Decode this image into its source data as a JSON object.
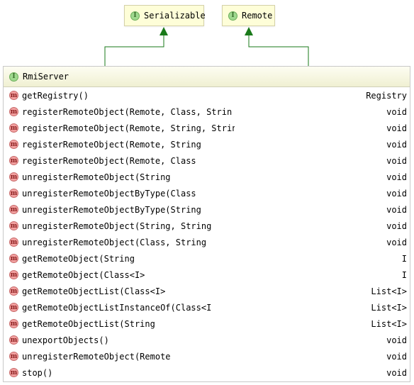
{
  "parents": [
    {
      "name": "Serializable",
      "badge": "I"
    },
    {
      "name": "Remote",
      "badge": "I"
    }
  ],
  "class": {
    "name": "RmiServer",
    "badge": "I",
    "methods": [
      {
        "badge": "m",
        "name": "getRegistry()",
        "type": "Registry"
      },
      {
        "badge": "m",
        "name": "registerRemoteObject(Remote, Class, Strin",
        "type": "void"
      },
      {
        "badge": "m",
        "name": "registerRemoteObject(Remote, String, Strin",
        "type": "void"
      },
      {
        "badge": "m",
        "name": "registerRemoteObject(Remote, String",
        "type": "void"
      },
      {
        "badge": "m",
        "name": "registerRemoteObject(Remote, Class",
        "type": "void"
      },
      {
        "badge": "m",
        "name": "unregisterRemoteObject(String",
        "type": "void"
      },
      {
        "badge": "m",
        "name": "unregisterRemoteObjectByType(Class",
        "type": "void"
      },
      {
        "badge": "m",
        "name": "unregisterRemoteObjectByType(String",
        "type": "void"
      },
      {
        "badge": "m",
        "name": "unregisterRemoteObject(String, String",
        "type": "void"
      },
      {
        "badge": "m",
        "name": "unregisterRemoteObject(Class, String",
        "type": "void"
      },
      {
        "badge": "m",
        "name": "getRemoteObject(String",
        "type": "I"
      },
      {
        "badge": "m",
        "name": "getRemoteObject(Class<I>",
        "type": "I"
      },
      {
        "badge": "m",
        "name": "getRemoteObjectList(Class<I>",
        "type": "List<I>"
      },
      {
        "badge": "m",
        "name": "getRemoteObjectListInstanceOf(Class<I",
        "type": "List<I>"
      },
      {
        "badge": "m",
        "name": "getRemoteObjectList(String",
        "type": "List<I>"
      },
      {
        "badge": "m",
        "name": "unexportObjects()",
        "type": "void"
      },
      {
        "badge": "m",
        "name": "unregisterRemoteObject(Remote",
        "type": "void"
      },
      {
        "badge": "m",
        "name": "stop()",
        "type": "void"
      }
    ]
  },
  "colors": {
    "edge": "#1a7a1a",
    "node_fill": "#fefed8"
  }
}
